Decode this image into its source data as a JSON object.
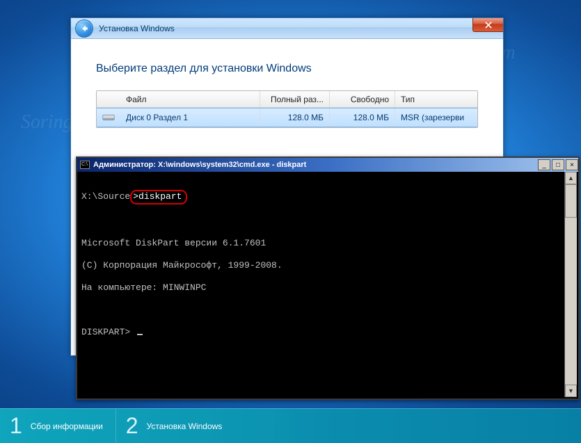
{
  "installer": {
    "title": "Установка Windows",
    "heading": "Выберите раздел для установки Windows",
    "columns": {
      "name": "Файл",
      "total": "Полный раз...",
      "free": "Свободно",
      "type": "Тип"
    },
    "row": {
      "name": "Диск 0 Раздел 1",
      "total": "128.0 МБ",
      "free": "128.0 МБ",
      "type": "MSR (зарезерви"
    }
  },
  "cmd": {
    "title": "Администратор: X:\\windows\\system32\\cmd.exe - diskpart",
    "prompt_prefix": "X:\\Source",
    "prompt_cmd": ">diskpart",
    "lines": [
      "Microsoft DiskPart версии 6.1.7601",
      "(C) Корпорация Майкрософт, 1999-2008.",
      "На компьютере: MINWINPC"
    ],
    "final_prompt": "DISKPART> "
  },
  "steps": {
    "s1_num": "1",
    "s1_label": "Сбор информации",
    "s2_num": "2",
    "s2_label": "Установка Windows"
  }
}
